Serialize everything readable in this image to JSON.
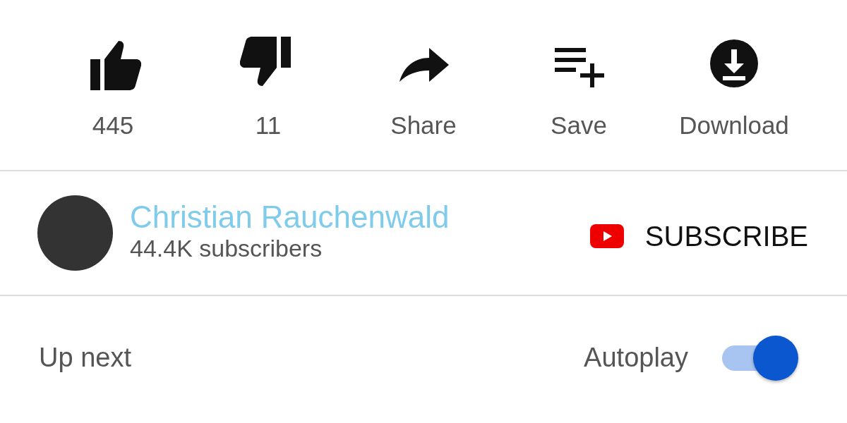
{
  "actions": [
    {
      "kind": "like",
      "label": "445"
    },
    {
      "kind": "dislike",
      "label": "11"
    },
    {
      "kind": "share",
      "label": "Share"
    },
    {
      "kind": "save",
      "label": "Save"
    },
    {
      "kind": "download",
      "label": "Download"
    }
  ],
  "channel": {
    "name": "Christian Rauchenwald",
    "subscribers": "44.4K subscribers",
    "subscribe": "SUBSCRIBE"
  },
  "up_next": {
    "title": "Up next",
    "autoplay": {
      "label": "Autoplay",
      "on": true
    }
  }
}
